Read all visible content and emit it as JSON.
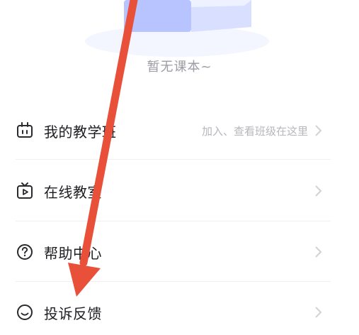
{
  "empty_state": {
    "text": "暂无课本~"
  },
  "menu": {
    "items": [
      {
        "label": "我的教学班",
        "hint": "加入、查看班级在这里",
        "icon": "class-icon"
      },
      {
        "label": "在线教室",
        "hint": "",
        "icon": "tv-icon"
      },
      {
        "label": "帮助中心",
        "hint": "",
        "icon": "help-icon"
      },
      {
        "label": "投诉反馈",
        "hint": "",
        "icon": "smile-icon"
      }
    ]
  },
  "annotation": {
    "icon": "red-arrow",
    "color": "#e8503a"
  },
  "colors": {
    "label": "#1e1e22",
    "hint": "#b6b6bc",
    "empty_text": "#9c9ca4",
    "illustration": "#b7c4ff"
  }
}
